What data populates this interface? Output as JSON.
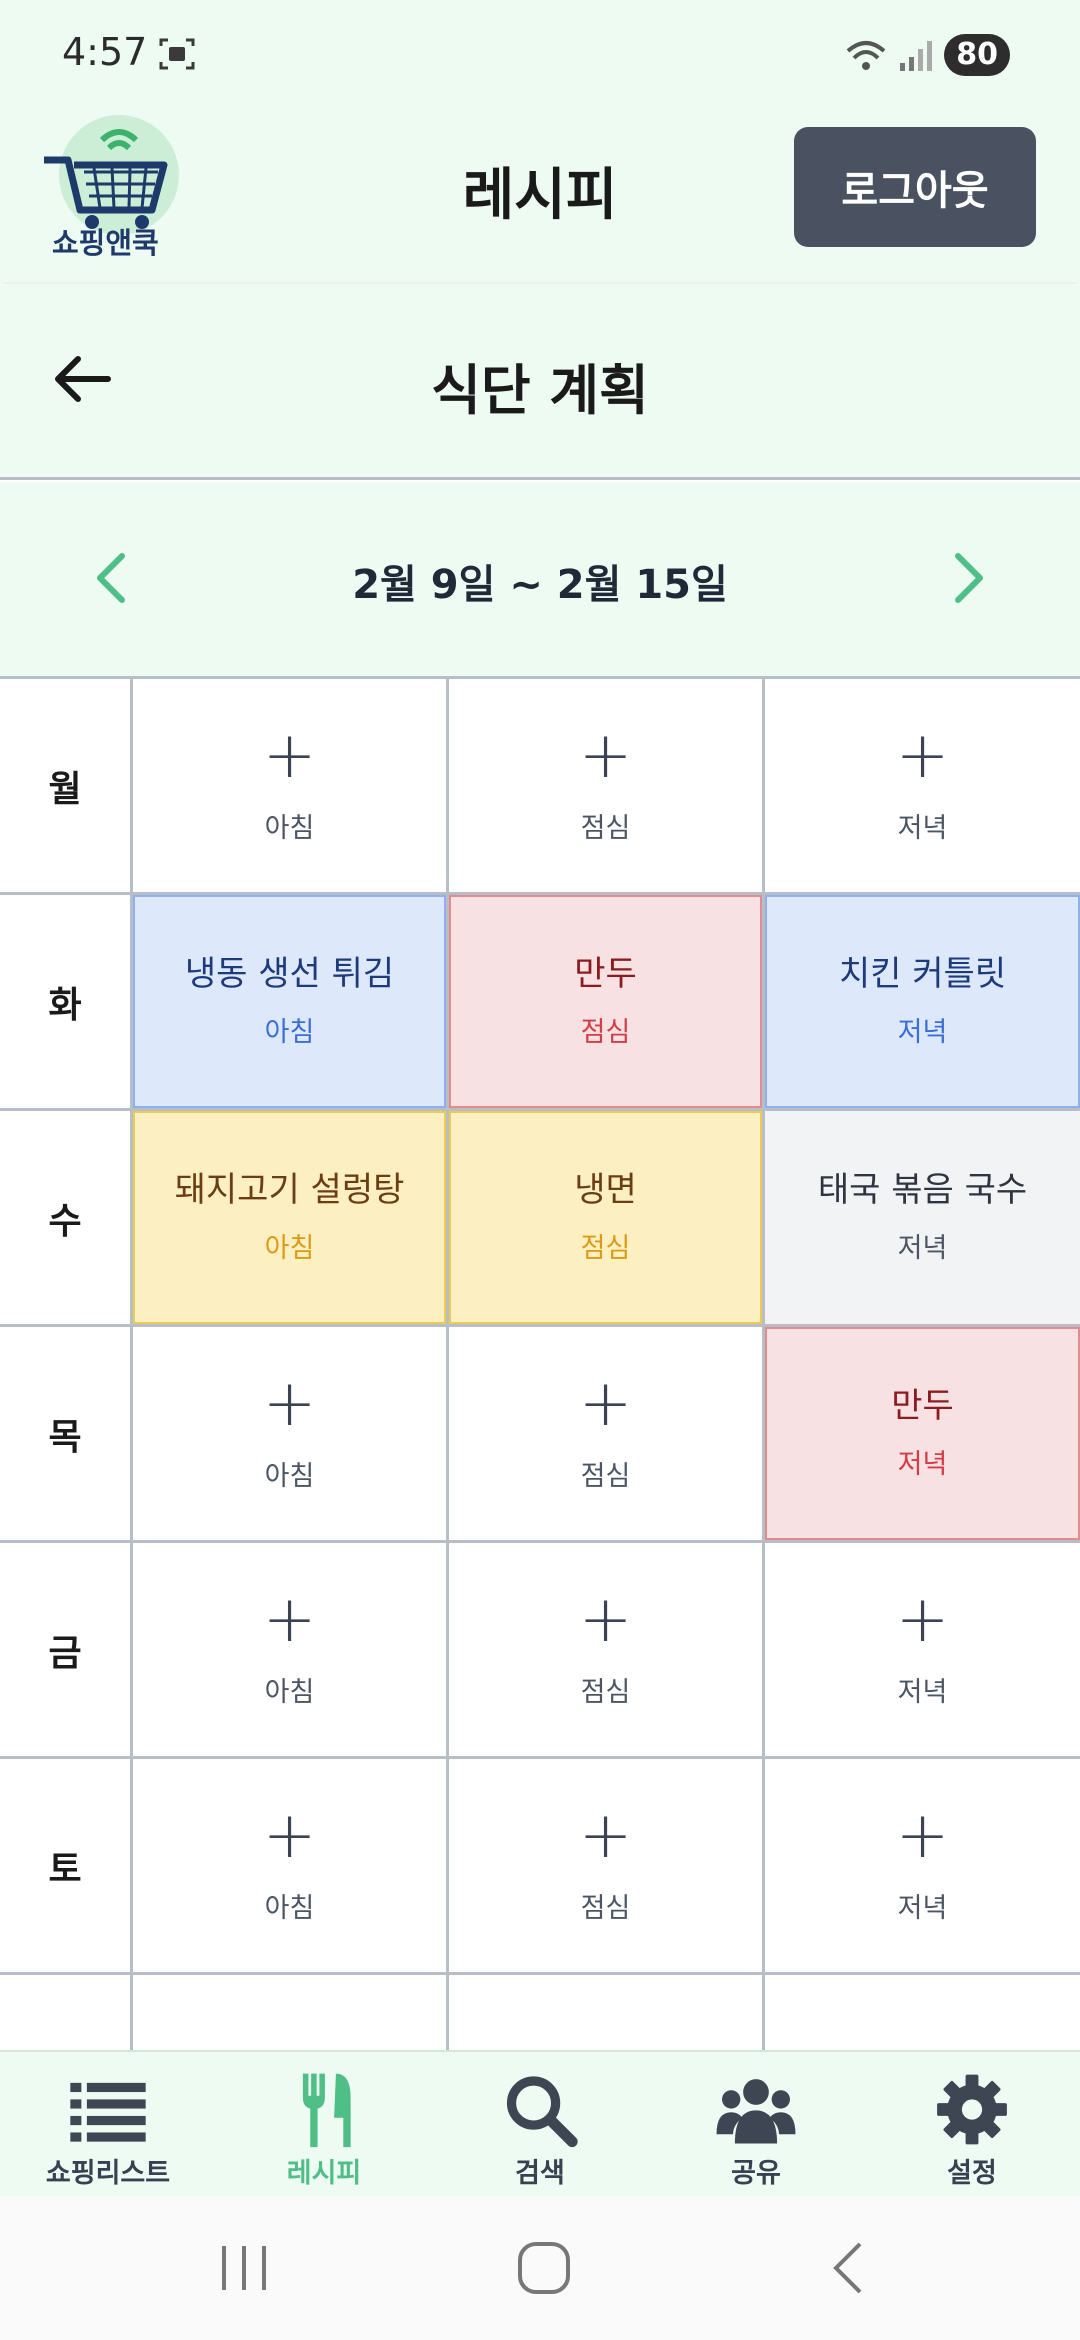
{
  "status_bar": {
    "time": "4:57",
    "battery": "80"
  },
  "header": {
    "logo_text": "쇼핑앤쿡",
    "title": "레시피",
    "logout_label": "로그아웃"
  },
  "subheader": {
    "title": "식단 계획"
  },
  "week": {
    "range": "2월 9일 ~ 2월 15일"
  },
  "meal_labels": {
    "breakfast": "아침",
    "lunch": "점심",
    "dinner": "저녁"
  },
  "days": [
    {
      "day": "월",
      "meals": [
        {
          "dish": "",
          "meal": "아침"
        },
        {
          "dish": "",
          "meal": "점심"
        },
        {
          "dish": "",
          "meal": "저녁"
        }
      ]
    },
    {
      "day": "화",
      "meals": [
        {
          "dish": "냉동 생선 튀김",
          "meal": "아침",
          "color": "blue"
        },
        {
          "dish": "만두",
          "meal": "점심",
          "color": "red"
        },
        {
          "dish": "치킨 커틀릿",
          "meal": "저녁",
          "color": "blue"
        }
      ]
    },
    {
      "day": "수",
      "meals": [
        {
          "dish": "돼지고기 설렁탕",
          "meal": "아침",
          "color": "yellow"
        },
        {
          "dish": "냉면",
          "meal": "점심",
          "color": "yellow"
        },
        {
          "dish": "태국 볶음 국수",
          "meal": "저녁",
          "color": "gray"
        }
      ]
    },
    {
      "day": "목",
      "meals": [
        {
          "dish": "",
          "meal": "아침"
        },
        {
          "dish": "",
          "meal": "점심"
        },
        {
          "dish": "만두",
          "meal": "저녁",
          "color": "red"
        }
      ]
    },
    {
      "day": "금",
      "meals": [
        {
          "dish": "",
          "meal": "아침"
        },
        {
          "dish": "",
          "meal": "점심"
        },
        {
          "dish": "",
          "meal": "저녁"
        }
      ]
    },
    {
      "day": "토",
      "meals": [
        {
          "dish": "",
          "meal": "아침"
        },
        {
          "dish": "",
          "meal": "점심"
        },
        {
          "dish": "",
          "meal": "저녁"
        }
      ]
    },
    {
      "day": "",
      "meals": [
        {
          "dish": "",
          "meal": ""
        },
        {
          "dish": "",
          "meal": ""
        },
        {
          "dish": "",
          "meal": ""
        }
      ]
    }
  ],
  "bottom_nav": [
    {
      "label": "쇼핑리스트",
      "icon": "list-icon"
    },
    {
      "label": "레시피",
      "icon": "utensils-icon",
      "active": true
    },
    {
      "label": "검색",
      "icon": "search-icon"
    },
    {
      "label": "공유",
      "icon": "users-icon"
    },
    {
      "label": "설정",
      "icon": "gear-icon"
    }
  ],
  "colors": {
    "accent": "#4fbf87",
    "header_bg": "#edfbf3",
    "logout_bg": "#4a5160",
    "blue_cell": "#dde8fb",
    "red_cell": "#f8e1e2",
    "yellow_cell": "#fcf0c3",
    "gray_cell": "#f2f3f5"
  }
}
